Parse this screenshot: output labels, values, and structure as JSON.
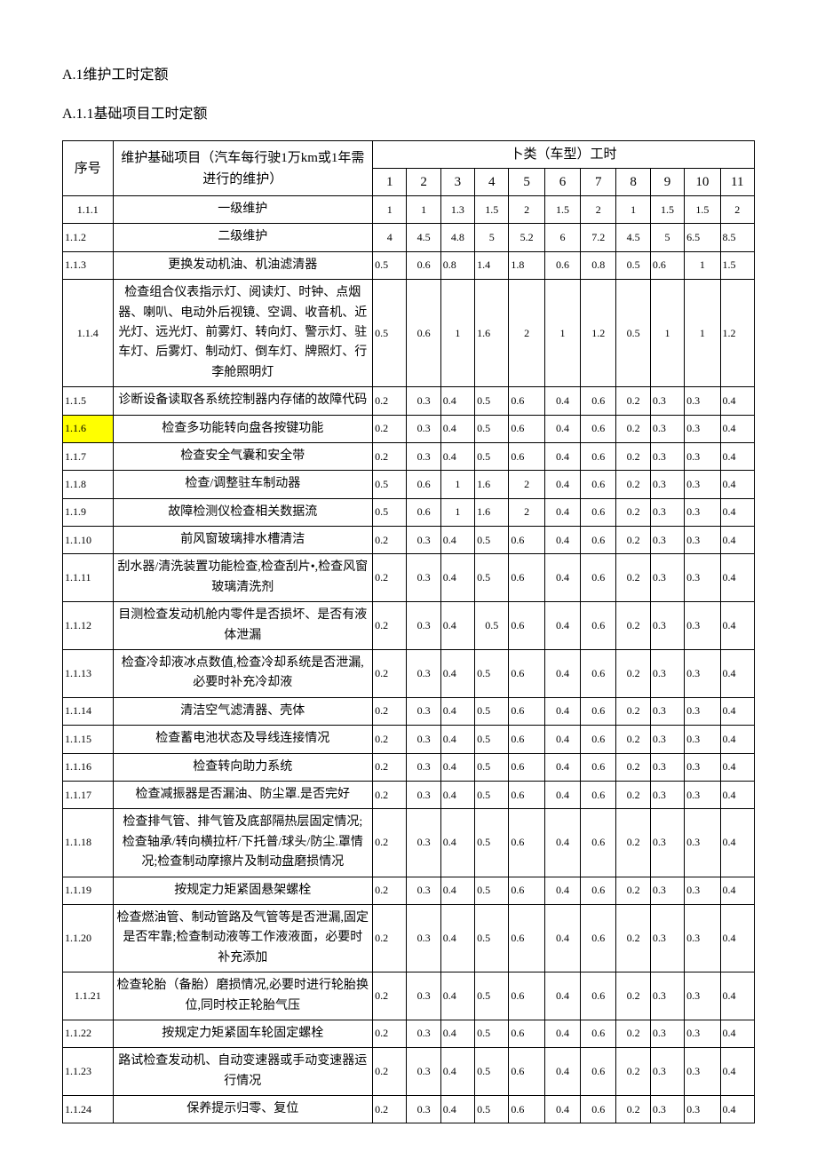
{
  "headings": {
    "h1": "A.1维护工时定额",
    "h2": "A.1.1基础项目工时定额"
  },
  "table": {
    "header": {
      "idx": "序号",
      "desc": "维护基础项目（汽车每行驶1万km或1年需进行的维护）",
      "group": "卜类（车型）工时",
      "cols": [
        "1",
        "2",
        "3",
        "4",
        "5",
        "6",
        "7",
        "8",
        "9",
        "10",
        "11"
      ]
    },
    "rows": [
      {
        "idx": "1.1.1",
        "idxCenter": true,
        "desc": "一级维护",
        "v": [
          "1",
          "1",
          "1.3",
          "1.5",
          "2",
          "1.5",
          "2",
          "1",
          "1.5",
          "1.5",
          "2"
        ],
        "center": [
          true,
          true,
          true,
          true,
          true,
          true,
          true,
          true,
          true,
          true,
          true
        ]
      },
      {
        "idx": "1.1.2",
        "desc": "二级维护",
        "v": [
          "4",
          "4.5",
          "4.8",
          "5",
          "5.2",
          "6",
          "7.2",
          "4.5",
          "5",
          "6.5",
          "8.5"
        ],
        "center": [
          true,
          true,
          true,
          true,
          true,
          true,
          true,
          true,
          true,
          false,
          false
        ]
      },
      {
        "idx": "1.1.3",
        "desc": "更换发动机油、机油滤清器",
        "v": [
          "0.5",
          "0.6",
          "0.8",
          "1.4",
          "1.8",
          "0.6",
          "0.8",
          "0.5",
          "0.6",
          "1",
          "1.5"
        ],
        "center": [
          false,
          true,
          false,
          false,
          false,
          true,
          true,
          true,
          false,
          true,
          false
        ]
      },
      {
        "idx": "1.1.4",
        "idxCenter": true,
        "desc": "检查组合仪表指示灯、阅读灯、时钟、点烟器、喇叭、电动外后视镜、空调、收音机、近光灯、远光灯、前雾灯、转向灯、警示灯、驻车灯、后雾灯、制动灯、倒车灯、牌照灯、行李舱照明灯",
        "v": [
          "0.5",
          "0.6",
          "1",
          "1.6",
          "2",
          "1",
          "1.2",
          "0.5",
          "1",
          "1",
          "1.2"
        ],
        "center": [
          false,
          true,
          true,
          false,
          true,
          true,
          true,
          true,
          true,
          true,
          false
        ]
      },
      {
        "idx": "1.1.5",
        "desc": "诊断设备读取各系统控制器内存储的故障代码",
        "v": [
          "0.2",
          "0.3",
          "0.4",
          "0.5",
          "0.6",
          "0.4",
          "0.6",
          "0.2",
          "0.3",
          "0.3",
          "0.4"
        ],
        "center": [
          false,
          true,
          false,
          false,
          false,
          true,
          true,
          true,
          false,
          false,
          false
        ]
      },
      {
        "idx": "1.1.6",
        "hl": true,
        "desc": "检查多功能转向盘各按键功能",
        "v": [
          "0.2",
          "0.3",
          "0.4",
          "0.5",
          "0.6",
          "0.4",
          "0.6",
          "0.2",
          "0.3",
          "0.3",
          "0.4"
        ],
        "center": [
          false,
          true,
          false,
          false,
          false,
          true,
          true,
          true,
          false,
          false,
          false
        ]
      },
      {
        "idx": "1.1.7",
        "desc": "检查安全气囊和安全带",
        "v": [
          "0.2",
          "0.3",
          "0.4",
          "0.5",
          "0.6",
          "0.4",
          "0.6",
          "0.2",
          "0.3",
          "0.3",
          "0.4"
        ],
        "center": [
          false,
          true,
          false,
          false,
          false,
          true,
          true,
          true,
          false,
          false,
          false
        ]
      },
      {
        "idx": "1.1.8",
        "desc": "检查/调整驻车制动器",
        "v": [
          "0.5",
          "0.6",
          "1",
          "1.6",
          "2",
          "0.4",
          "0.6",
          "0.2",
          "0.3",
          "0.3",
          "0.4"
        ],
        "center": [
          false,
          true,
          true,
          false,
          true,
          true,
          true,
          true,
          false,
          false,
          false
        ]
      },
      {
        "idx": "1.1.9",
        "desc": "故障检测仪检查相关数据流",
        "v": [
          "0.5",
          "0.6",
          "1",
          "1.6",
          "2",
          "0.4",
          "0.6",
          "0.2",
          "0.3",
          "0.3",
          "0.4"
        ],
        "center": [
          false,
          true,
          true,
          false,
          true,
          true,
          true,
          true,
          false,
          false,
          false
        ]
      },
      {
        "idx": "1.1.10",
        "desc": "前风窗玻璃排水槽清洁",
        "v": [
          "0.2",
          "0.3",
          "0.4",
          "0.5",
          "0.6",
          "0.4",
          "0.6",
          "0.2",
          "0.3",
          "0.3",
          "0.4"
        ],
        "center": [
          false,
          true,
          false,
          false,
          false,
          true,
          true,
          true,
          false,
          false,
          false
        ]
      },
      {
        "idx": "1.1.11",
        "desc": "刮水器/清洗装置功能检查,检查刮片•,检查风窗玻璃清洗剂",
        "v": [
          "0.2",
          "0.3",
          "0.4",
          "0.5",
          "0.6",
          "0.4",
          "0.6",
          "0.2",
          "0.3",
          "0.3",
          "0.4"
        ],
        "center": [
          false,
          true,
          false,
          false,
          false,
          true,
          true,
          true,
          false,
          false,
          false
        ]
      },
      {
        "idx": "1.1.12",
        "desc": "目测检查发动机舱内零件是否损坏、是否有液体泄漏",
        "v": [
          "0.2",
          "0.3",
          "0.4",
          "0.5",
          "0.6",
          "0.4",
          "0.6",
          "0.2",
          "0.3",
          "0.3",
          "0.4"
        ],
        "center": [
          false,
          true,
          false,
          true,
          false,
          true,
          true,
          true,
          false,
          false,
          false
        ]
      },
      {
        "idx": "1.1.13",
        "desc": "检查冷却液冰点数值,检查冷却系统是否泄漏,必要时补充冷却液",
        "v": [
          "0.2",
          "0.3",
          "0.4",
          "0.5",
          "0.6",
          "0.4",
          "0.6",
          "0.2",
          "0.3",
          "0.3",
          "0.4"
        ],
        "center": [
          false,
          true,
          false,
          false,
          false,
          true,
          true,
          true,
          false,
          false,
          false
        ]
      },
      {
        "idx": "1.1.14",
        "desc": "清洁空气滤清器、壳体",
        "v": [
          "0.2",
          "0.3",
          "0.4",
          "0.5",
          "0.6",
          "0.4",
          "0.6",
          "0.2",
          "0.3",
          "0.3",
          "0.4"
        ],
        "center": [
          false,
          true,
          false,
          false,
          false,
          true,
          true,
          true,
          false,
          false,
          false
        ]
      },
      {
        "idx": "1.1.15",
        "desc": "检查蓄电池状态及导线连接情况",
        "v": [
          "0.2",
          "0.3",
          "0.4",
          "0.5",
          "0.6",
          "0.4",
          "0.6",
          "0.2",
          "0.3",
          "0.3",
          "0.4"
        ],
        "center": [
          false,
          true,
          false,
          false,
          false,
          true,
          true,
          true,
          false,
          false,
          false
        ]
      },
      {
        "idx": "1.1.16",
        "desc": "检查转向助力系统",
        "v": [
          "0.2",
          "0.3",
          "0.4",
          "0.5",
          "0.6",
          "0.4",
          "0.6",
          "0.2",
          "0.3",
          "0.3",
          "0.4"
        ],
        "center": [
          false,
          true,
          false,
          false,
          false,
          true,
          true,
          true,
          false,
          false,
          false
        ]
      },
      {
        "idx": "1.1.17",
        "desc": "检查减振器是否漏油、防尘罩.是否完好",
        "v": [
          "0.2",
          "0.3",
          "0.4",
          "0.5",
          "0.6",
          "0.4",
          "0.6",
          "0.2",
          "0.3",
          "0.3",
          "0.4"
        ],
        "center": [
          false,
          true,
          false,
          false,
          false,
          true,
          true,
          true,
          false,
          false,
          false
        ]
      },
      {
        "idx": "1.1.18",
        "desc": "检查排气管、排气管及底部隔热层固定情况;检查轴承/转向横拉杆/下托普/球头/防尘.罩情况;检查制动摩擦片及制动盘磨损情况",
        "v": [
          "0.2",
          "0.3",
          "0.4",
          "0.5",
          "0.6",
          "0.4",
          "0.6",
          "0.2",
          "0.3",
          "0.3",
          "0.4"
        ],
        "center": [
          false,
          true,
          false,
          false,
          false,
          true,
          true,
          true,
          false,
          false,
          false
        ]
      },
      {
        "idx": "1.1.19",
        "desc": "按规定力矩紧固悬架螺栓",
        "v": [
          "0.2",
          "0.3",
          "0.4",
          "0.5",
          "0.6",
          "0.4",
          "0.6",
          "0.2",
          "0.3",
          "0.3",
          "0.4"
        ],
        "center": [
          false,
          true,
          false,
          false,
          false,
          true,
          true,
          true,
          false,
          false,
          false
        ]
      },
      {
        "idx": "1.1.20",
        "desc": "检查燃油管、制动管路及气管等是否泄漏,固定是否牢靠;检查制动液等工作液液面，必要时补充添加",
        "v": [
          "0.2",
          "0.3",
          "0.4",
          "0.5",
          "0.6",
          "0.4",
          "0.6",
          "0.2",
          "0.3",
          "0.3",
          "0.4"
        ],
        "center": [
          false,
          true,
          false,
          false,
          false,
          true,
          true,
          true,
          false,
          false,
          false
        ]
      },
      {
        "idx": "1.1.21",
        "idxCenter": true,
        "desc": "检查轮胎（备胎）磨损情况,必要时进行轮胎换位,同时校正轮胎气压",
        "v": [
          "0.2",
          "0.3",
          "0.4",
          "0.5",
          "0.6",
          "0.4",
          "0.6",
          "0.2",
          "0.3",
          "0.3",
          "0.4"
        ],
        "center": [
          false,
          true,
          false,
          false,
          false,
          true,
          true,
          true,
          false,
          false,
          false
        ]
      },
      {
        "idx": "1.1.22",
        "desc": "按规定力矩紧固车轮固定螺栓",
        "v": [
          "0.2",
          "0.3",
          "0.4",
          "0.5",
          "0.6",
          "0.4",
          "0.6",
          "0.2",
          "0.3",
          "0.3",
          "0.4"
        ],
        "center": [
          false,
          true,
          false,
          false,
          false,
          true,
          true,
          true,
          false,
          false,
          false
        ]
      },
      {
        "idx": "1.1.23",
        "desc": "路试检查发动机、自动变速器或手动变速器运行情况",
        "v": [
          "0.2",
          "0.3",
          "0.4",
          "0.5",
          "0.6",
          "0.4",
          "0.6",
          "0.2",
          "0.3",
          "0.3",
          "0.4"
        ],
        "center": [
          false,
          true,
          false,
          false,
          false,
          true,
          true,
          true,
          false,
          false,
          false
        ]
      },
      {
        "idx": "1.1.24",
        "desc": "保养提示归零、复位",
        "v": [
          "0.2",
          "0.3",
          "0.4",
          "0.5",
          "0.6",
          "0.4",
          "0.6",
          "0.2",
          "0.3",
          "0.3",
          "0.4"
        ],
        "center": [
          false,
          true,
          false,
          false,
          false,
          true,
          true,
          true,
          false,
          false,
          false
        ]
      }
    ]
  }
}
